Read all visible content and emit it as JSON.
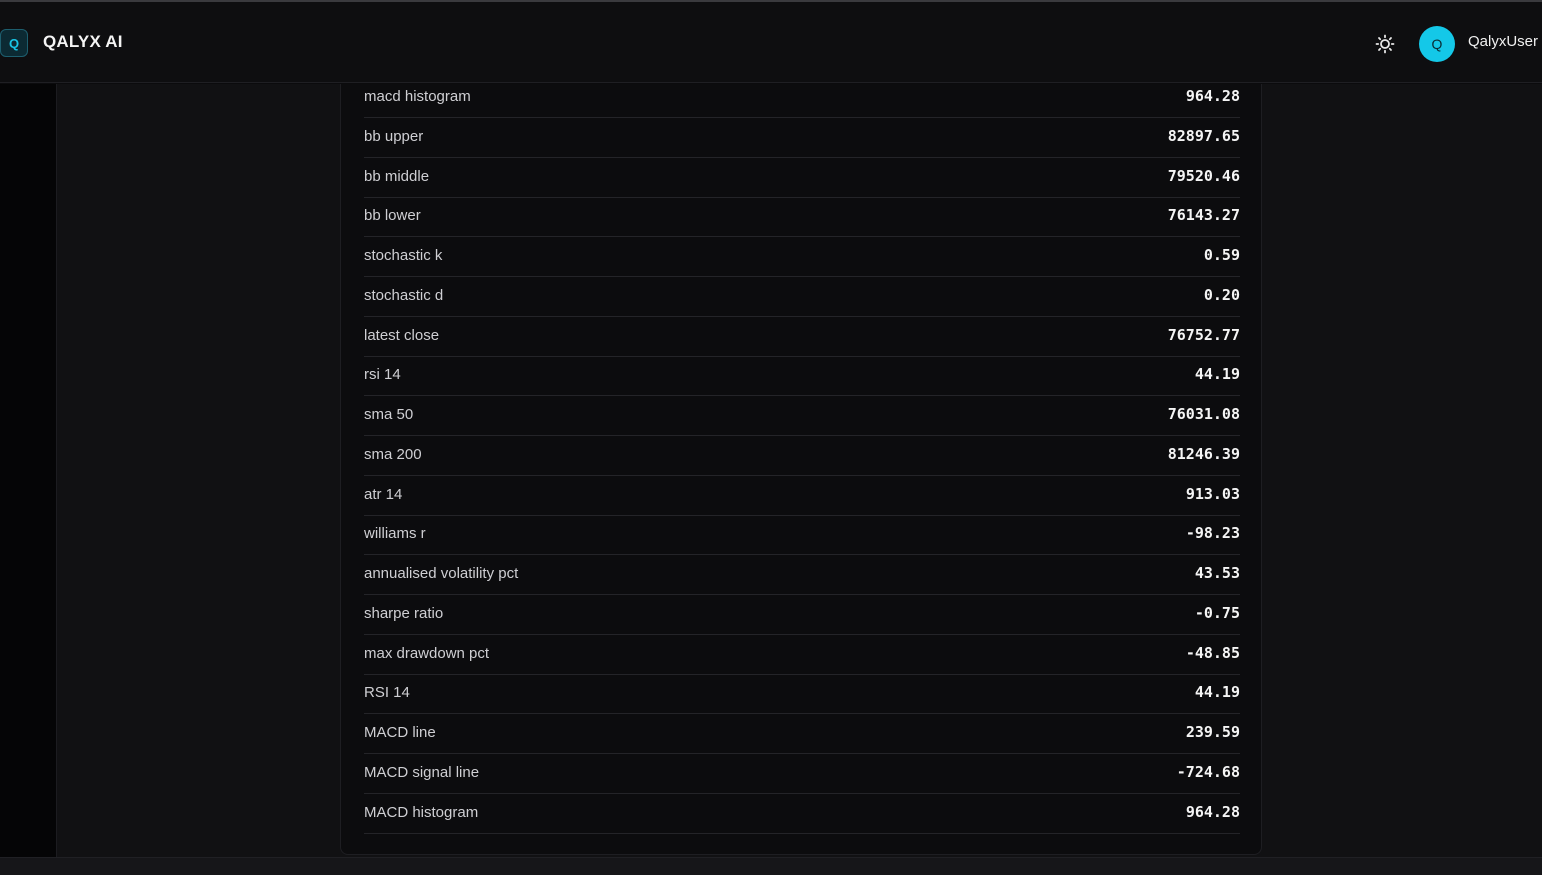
{
  "app": {
    "logo_letter": "Q",
    "brand": "QALYX AI",
    "user_avatar_letter": "Q",
    "username": "QalyxUser"
  },
  "icons": {
    "theme": "sun-icon"
  },
  "table": {
    "rows": [
      {
        "label": "macd histogram",
        "value": "964.28"
      },
      {
        "label": "bb upper",
        "value": "82897.65"
      },
      {
        "label": "bb middle",
        "value": "79520.46"
      },
      {
        "label": "bb lower",
        "value": "76143.27"
      },
      {
        "label": "stochastic k",
        "value": "0.59"
      },
      {
        "label": "stochastic d",
        "value": "0.20"
      },
      {
        "label": "latest close",
        "value": "76752.77"
      },
      {
        "label": "rsi 14",
        "value": "44.19"
      },
      {
        "label": "sma 50",
        "value": "76031.08"
      },
      {
        "label": "sma 200",
        "value": "81246.39"
      },
      {
        "label": "atr 14",
        "value": "913.03"
      },
      {
        "label": "williams r",
        "value": "-98.23"
      },
      {
        "label": "annualised volatility pct",
        "value": "43.53"
      },
      {
        "label": "sharpe ratio",
        "value": "-0.75"
      },
      {
        "label": "max drawdown pct",
        "value": "-48.85"
      },
      {
        "label": "RSI 14",
        "value": "44.19"
      },
      {
        "label": "MACD line",
        "value": "239.59"
      },
      {
        "label": "MACD signal line",
        "value": "-724.68"
      },
      {
        "label": "MACD histogram",
        "value": "964.28"
      }
    ]
  }
}
